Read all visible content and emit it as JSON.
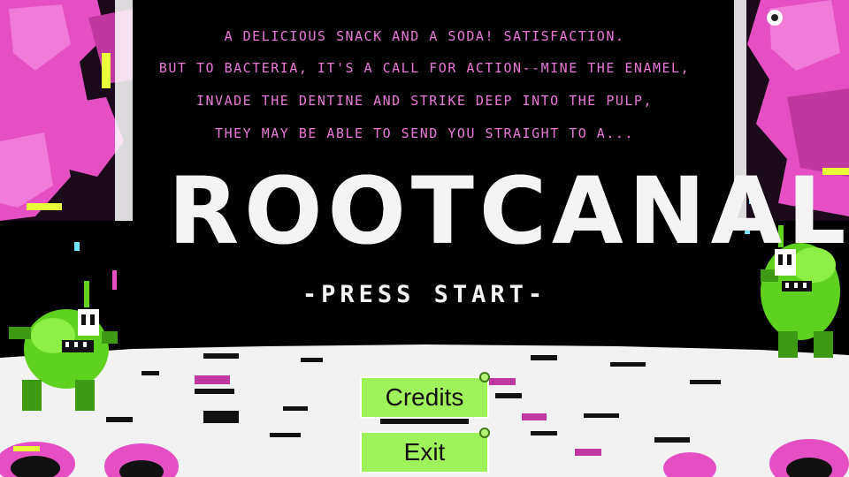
{
  "intro_lines": [
    "A DELICIOUS SNACK AND A SODA! SATISFACTION.",
    "BUT TO BACTERIA, IT'S A CALL FOR ACTION--MINE THE ENAMEL,",
    "INVADE THE DENTINE AND STRIKE DEEP INTO THE PULP,",
    "THEY MAY BE ABLE TO SEND YOU STRAIGHT TO A..."
  ],
  "title": "ROOTCANAL",
  "press_start": "-PRESS START-",
  "menu": {
    "credits_label": "Credits",
    "exit_label": "Exit"
  },
  "colors": {
    "intro_text": "#e879d9",
    "title_text": "#f4f4f4",
    "button_fill": "#9ef25a",
    "tissue_pink": "#e64ec4",
    "bacteria_green": "#5fd11f",
    "enamel_floor": "#f2f2f2"
  }
}
